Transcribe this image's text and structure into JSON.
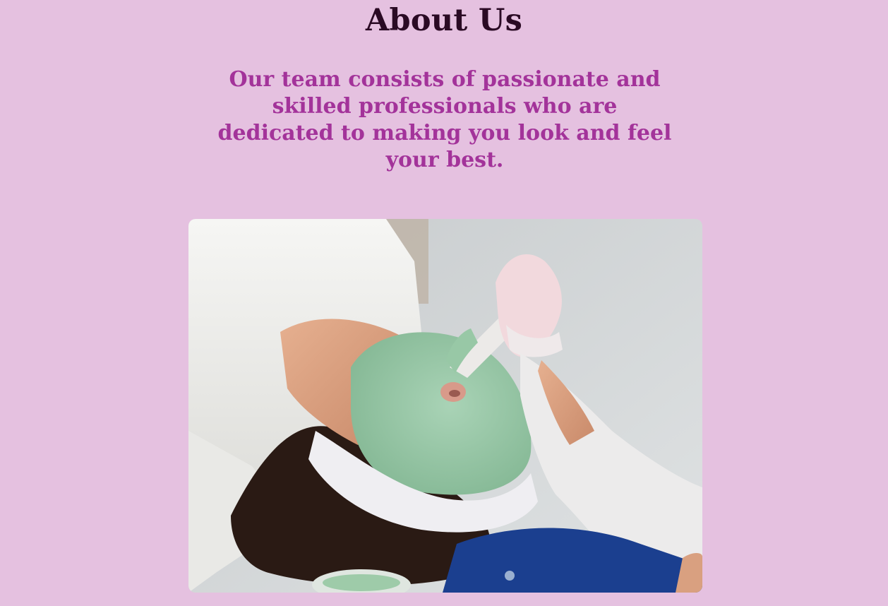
{
  "about": {
    "title": "About Us",
    "description": "Our team consists of passionate and skilled professionals who are dedicated to making you look and feel your best."
  },
  "photo": {
    "subject": "facial-mask-treatment-photo"
  },
  "colors": {
    "background": "#e5c1e0",
    "title": "#2a0a24",
    "accent": "#a3339a"
  }
}
